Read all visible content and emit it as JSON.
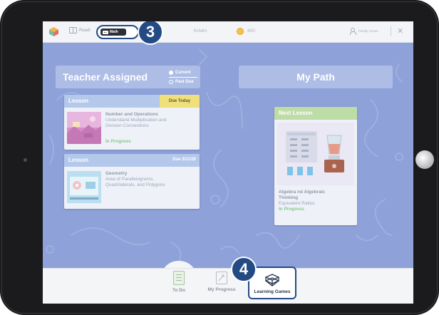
{
  "topbar": {
    "reading_label": "Readi",
    "math_label": "Math",
    "user_name": "Kristin",
    "coins": "400",
    "family_center": "Family Center",
    "close_symbol": "✕"
  },
  "callouts": {
    "three": "3",
    "four": "4"
  },
  "teacher_assigned": {
    "title": "Teacher Assigned",
    "filters": [
      {
        "label": "Current",
        "selected": true
      },
      {
        "label": "Past Due",
        "selected": false
      }
    ],
    "cards": [
      {
        "type": "Lesson",
        "due": "Due Today",
        "title": "Number and Operations",
        "lines": [
          "Understand Multiplication and",
          "Division Connections"
        ],
        "status": "In Progress"
      },
      {
        "type": "Lesson",
        "due": "Due 3/11/20",
        "title": "Geometry",
        "lines": [
          "Area of Parallelograms,",
          "Quadrilaterals, and Polygons"
        ],
        "status": ""
      }
    ]
  },
  "my_path": {
    "title": "My Path",
    "next_card": {
      "header": "Next Lesson",
      "title_lines": [
        "Algebra nd Algebraic",
        "Thinking"
      ],
      "subtitle": "Equivalent Ratios",
      "status": "In Progress"
    }
  },
  "bottom_nav": {
    "items": [
      {
        "label": "To Do"
      },
      {
        "label": "My Progress"
      },
      {
        "label": "Learning Games"
      }
    ]
  },
  "colors": {
    "screen_bg": "#8ea1d8",
    "callout": "#234a84",
    "status_green": "#87c88e",
    "due_today": "#f0e07a",
    "next_lesson_header": "#bedca6"
  }
}
